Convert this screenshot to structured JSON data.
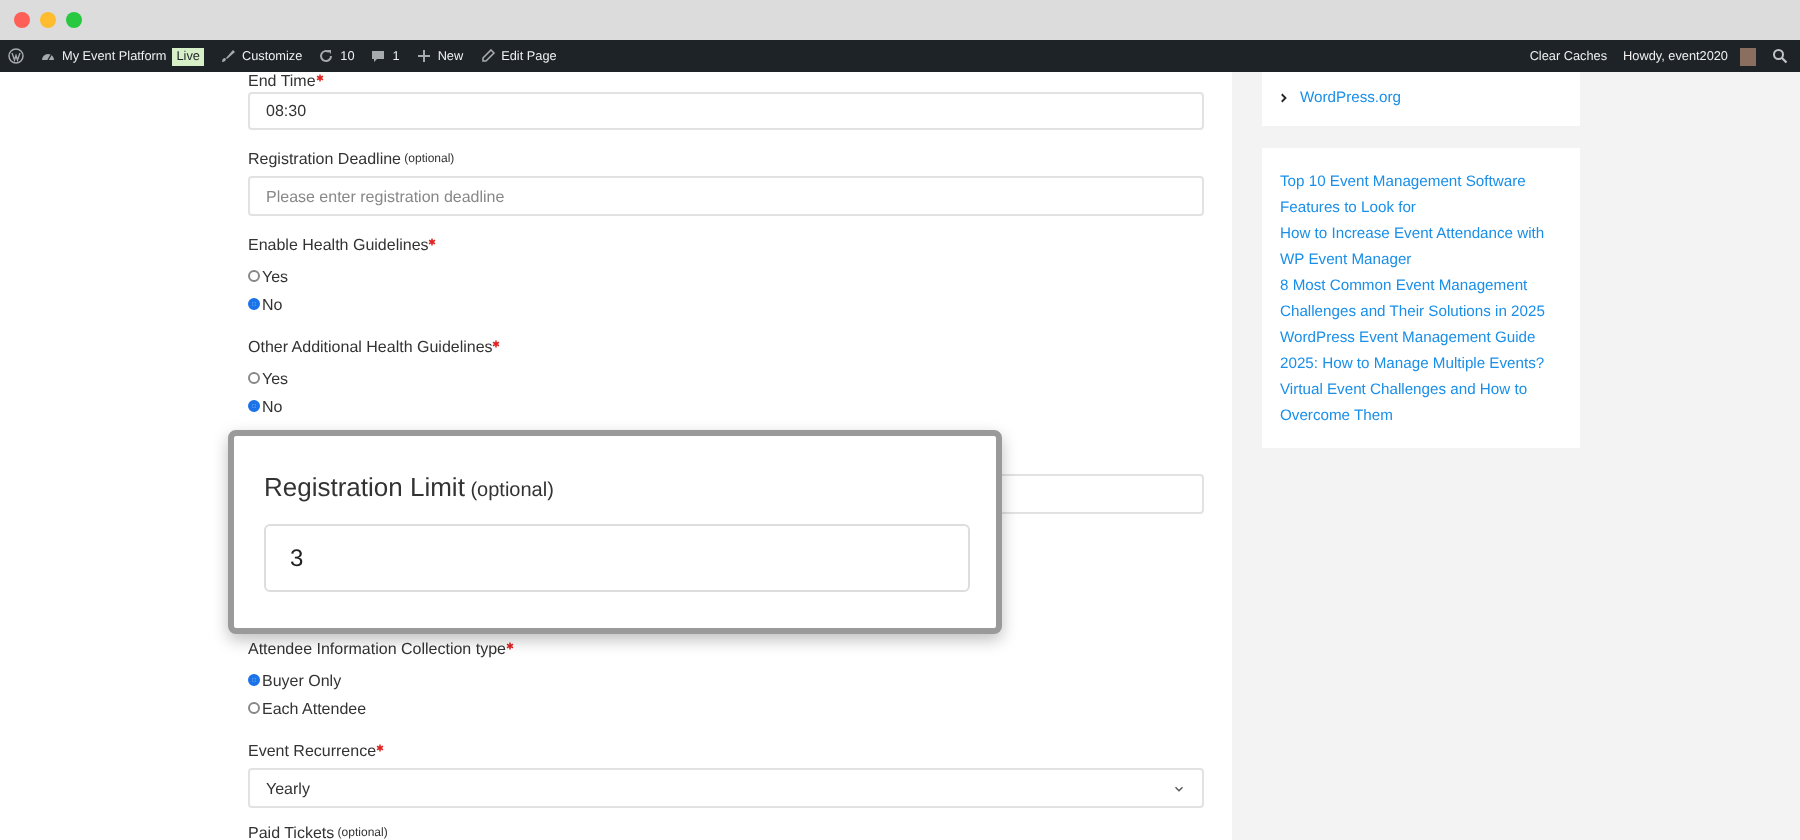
{
  "admin_bar": {
    "left": [
      {
        "kind": "logo"
      },
      {
        "kind": "site",
        "label": "My Event Platform",
        "badge": "Live"
      },
      {
        "kind": "customize",
        "label": "Customize"
      },
      {
        "kind": "updates",
        "label": "10"
      },
      {
        "kind": "comments",
        "label": "1"
      },
      {
        "kind": "new",
        "label": "New"
      },
      {
        "kind": "edit",
        "label": "Edit Page"
      }
    ],
    "right": [
      {
        "kind": "text",
        "label": "Clear Caches"
      },
      {
        "kind": "account",
        "label": "Howdy, event2020"
      },
      {
        "kind": "search"
      }
    ]
  },
  "form": {
    "fields": [
      {
        "kind": "text",
        "label": "End Time",
        "required": true,
        "value": "08:30"
      },
      {
        "kind": "text",
        "label": "Registration Deadline",
        "optional": "(optional)",
        "placeholder": "Please enter registration deadline"
      },
      {
        "kind": "radio",
        "label": "Enable Health Guidelines",
        "required": true,
        "options": [
          {
            "label": "Yes",
            "selected": false
          },
          {
            "label": "No",
            "selected": true
          }
        ]
      },
      {
        "kind": "radio",
        "label": "Other Additional Health Guidelines",
        "required": true,
        "options": [
          {
            "label": "Yes",
            "selected": false
          },
          {
            "label": "No",
            "selected": true
          }
        ]
      },
      {
        "kind": "covered"
      },
      {
        "kind": "radio",
        "label": "Attendee Information Collection type",
        "required": true,
        "options": [
          {
            "label": "Buyer Only",
            "selected": true
          },
          {
            "label": "Each Attendee",
            "selected": false
          }
        ]
      },
      {
        "kind": "select",
        "label": "Event Recurrence",
        "required": true,
        "value": "Yearly"
      },
      {
        "kind": "heading",
        "label": "Paid Tickets",
        "optional": "(optional)"
      }
    ]
  },
  "popup": {
    "label": "Registration Limit",
    "optional": "(optional)",
    "value": "3"
  },
  "sidebar": {
    "links": [
      "WordPress.org"
    ],
    "recent_posts": [
      "Top 10 Event Management Software Features to Look for",
      "How to Increase Event Attendance with WP Event Manager",
      "8 Most Common Event Management Challenges and Their Solutions in 2025",
      "WordPress Event Management Guide 2025: How to Manage Multiple Events?",
      "Virtual Event Challenges and How to Overcome Them"
    ]
  }
}
